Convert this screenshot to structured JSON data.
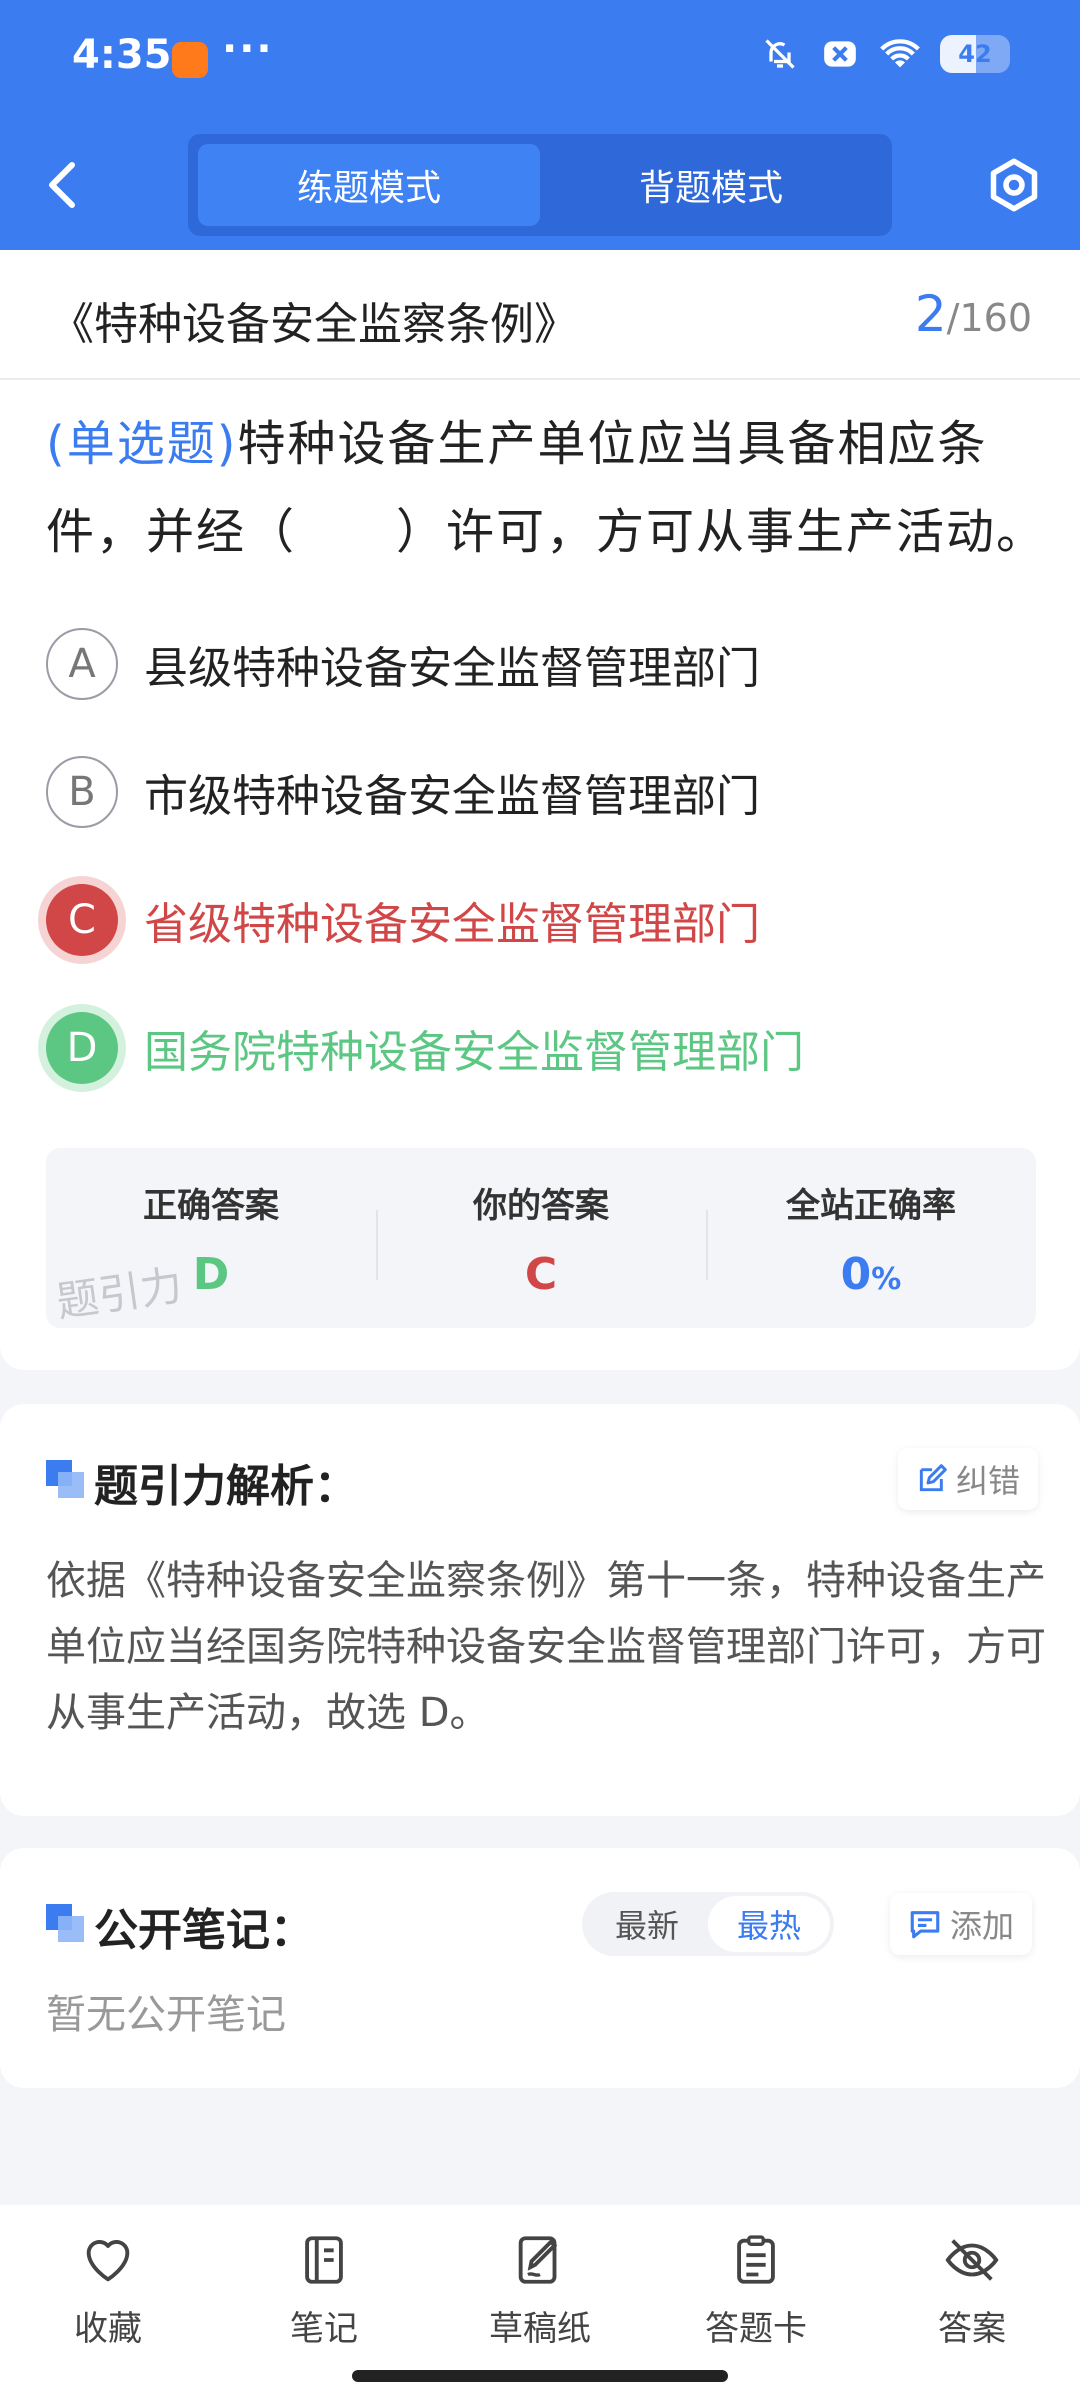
{
  "status_bar": {
    "time": "4:35",
    "more": "···",
    "battery": "42"
  },
  "header": {
    "tabs": [
      {
        "label": "练题模式",
        "active": true
      },
      {
        "label": "背题模式",
        "active": false
      }
    ],
    "accent_color": "#3b7cf0"
  },
  "question_header": {
    "title": "《特种设备安全监察条例》",
    "current": "2",
    "total": "/160"
  },
  "question": {
    "type": "(单选题)",
    "text": "特种设备生产单位应当具备相应条件，并经（　　）许可，方可从事生产活动。"
  },
  "options": [
    {
      "letter": "A",
      "text": "县级特种设备安全监督管理部门",
      "state": "normal"
    },
    {
      "letter": "B",
      "text": "市级特种设备安全监督管理部门",
      "state": "normal"
    },
    {
      "letter": "C",
      "text": "省级特种设备安全监督管理部门",
      "state": "wrong"
    },
    {
      "letter": "D",
      "text": "国务院特种设备安全监督管理部门",
      "state": "right"
    }
  ],
  "answer_summary": {
    "correct_label": "正确答案",
    "correct_value": "D",
    "yours_label": "你的答案",
    "yours_value": "C",
    "rate_label": "全站正确率",
    "rate_value": "0",
    "rate_unit": "%",
    "watermark": "题引力"
  },
  "analysis": {
    "title": "题引力解析：",
    "report_label": "纠错",
    "text": "依据《特种设备安全监察条例》第十一条，特种设备生产单位应当经国务院特种设备安全监督管理部门许可，方可从事生产活动，故选 D。"
  },
  "notes": {
    "title": "公开笔记：",
    "sort_options": [
      "最新",
      "最热"
    ],
    "sort_active": "最热",
    "add_label": "添加",
    "empty_text": "暂无公开笔记"
  },
  "bottom_nav": [
    {
      "label": "收藏",
      "icon": "heart-icon"
    },
    {
      "label": "笔记",
      "icon": "notebook-icon"
    },
    {
      "label": "草稿纸",
      "icon": "draft-icon"
    },
    {
      "label": "答题卡",
      "icon": "answer-card-icon"
    },
    {
      "label": "答案",
      "icon": "eye-off-icon"
    }
  ]
}
